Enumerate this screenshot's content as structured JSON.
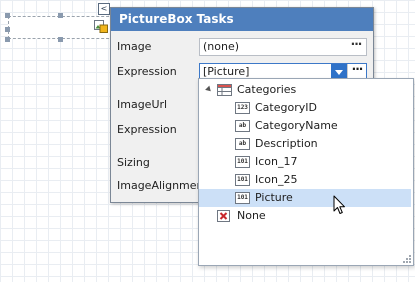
{
  "panel": {
    "title": "PictureBox Tasks",
    "smart_tag_glyph": "<",
    "rows": [
      {
        "label": "Image",
        "value": "(none)"
      },
      {
        "label": "Expression",
        "value": "[Picture]"
      },
      {
        "label": "ImageUrl"
      },
      {
        "label": "Expression"
      },
      {
        "label": "Sizing"
      },
      {
        "label": "ImageAlignment"
      }
    ],
    "ellipsis": "···"
  },
  "dropdown": {
    "root": {
      "label": "Categories",
      "icon": "table-icon"
    },
    "fields": [
      {
        "label": "CategoryID",
        "type_badge": "123",
        "icon": "number-field-icon"
      },
      {
        "label": "CategoryName",
        "type_badge": "ab",
        "icon": "text-field-icon"
      },
      {
        "label": "Description",
        "type_badge": "ab",
        "icon": "text-field-icon"
      },
      {
        "label": "Icon_17",
        "type_badge": "101",
        "icon": "binary-field-icon"
      },
      {
        "label": "Icon_25",
        "type_badge": "101",
        "icon": "binary-field-icon"
      },
      {
        "label": "Picture",
        "type_badge": "101",
        "icon": "binary-field-icon",
        "selected": true
      }
    ],
    "none": {
      "label": "None",
      "icon": "none-icon"
    }
  },
  "colors": {
    "header": "#4e7fbd",
    "accent": "#2f72c8",
    "selection": "#cce0f7",
    "none_mark": "#c8282d"
  }
}
